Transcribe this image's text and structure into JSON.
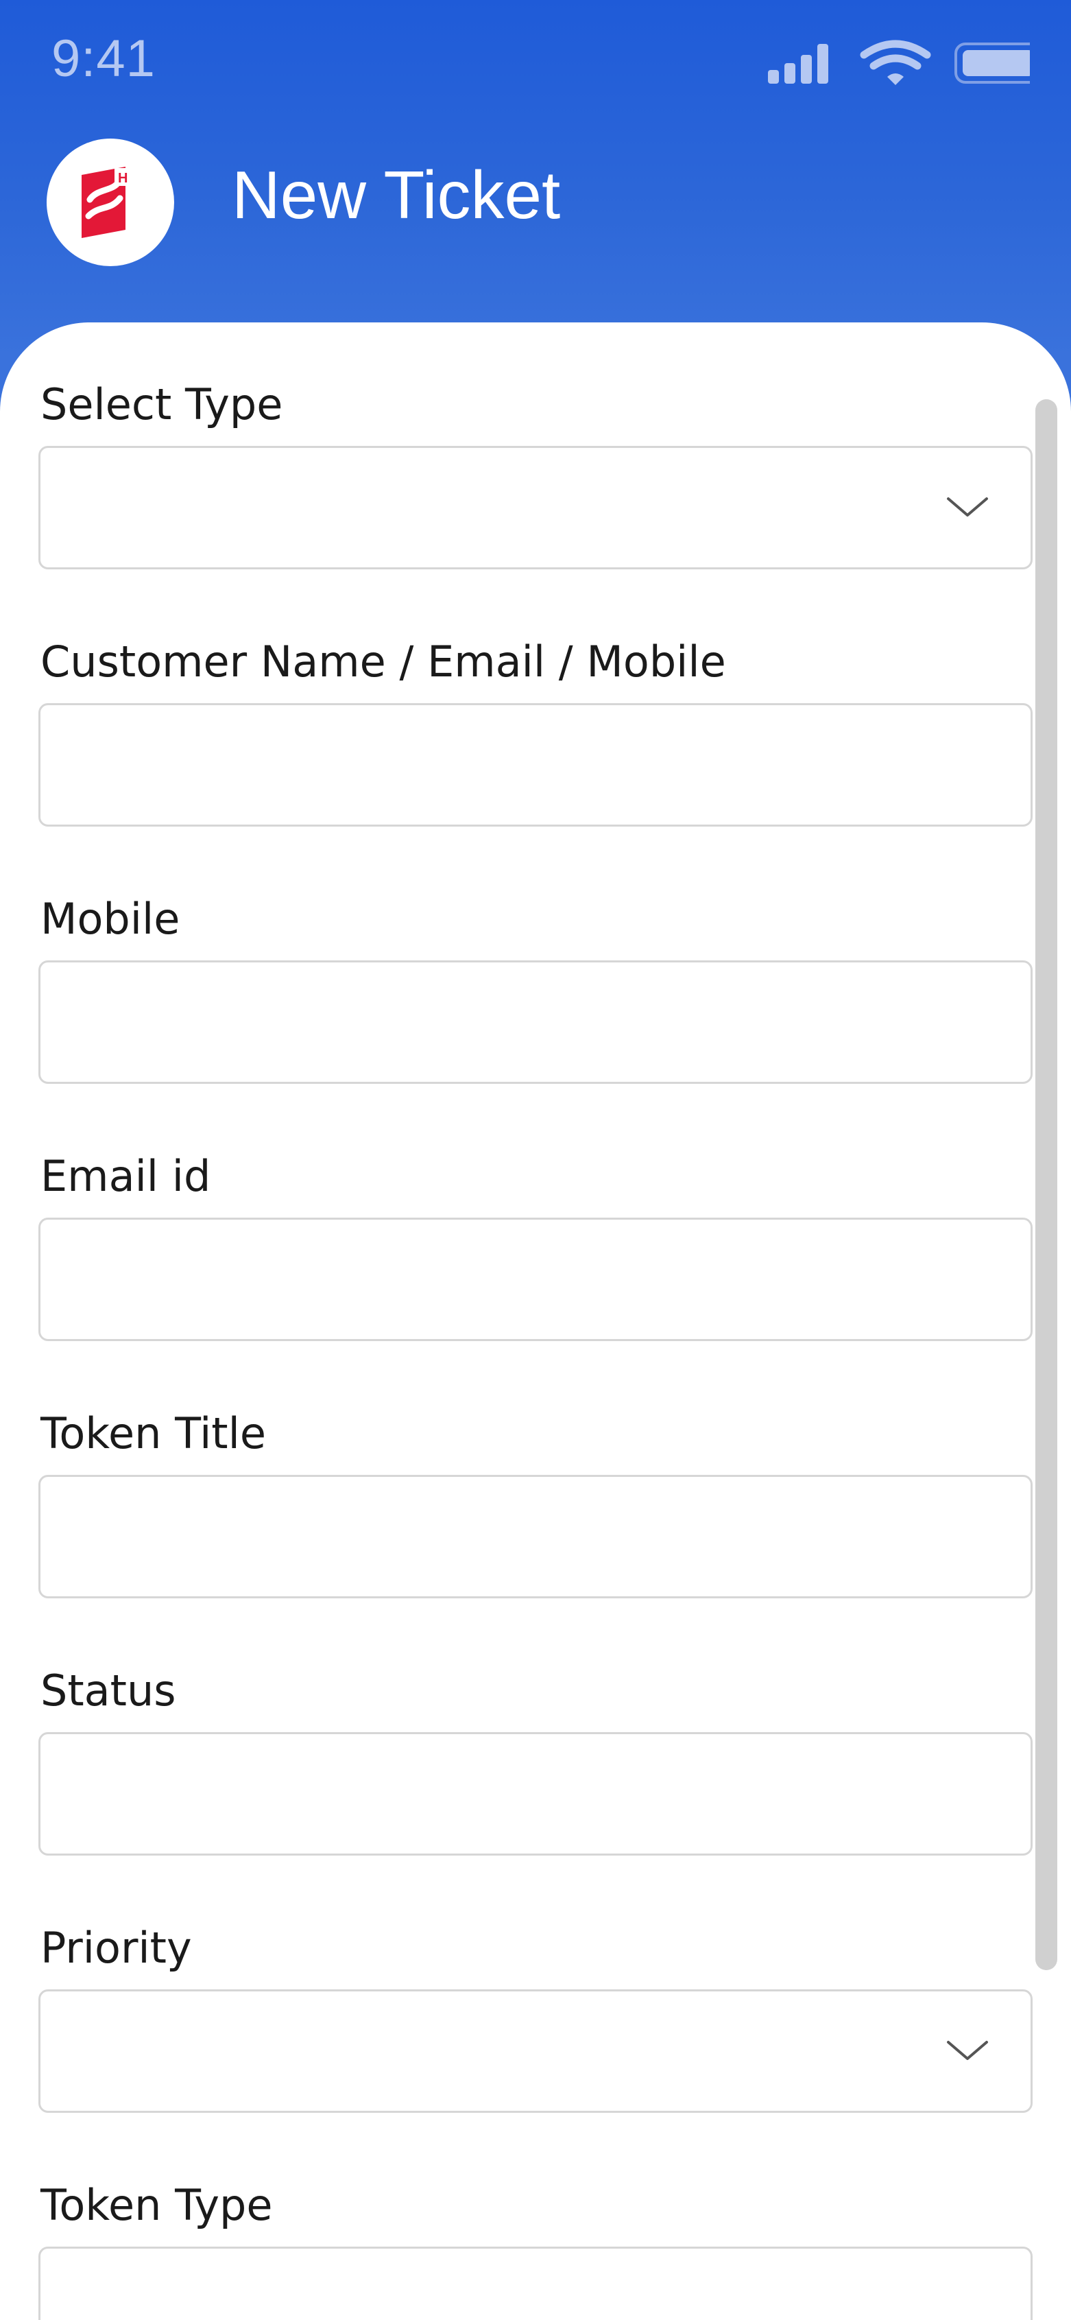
{
  "status_bar": {
    "time": "9:41",
    "icons": [
      "signal-icon",
      "wifi-icon",
      "battery-icon"
    ]
  },
  "header": {
    "title": "New Ticket",
    "logo_letters": "S",
    "logo_badge": "H"
  },
  "colors": {
    "header_blue": "#1f5bd8",
    "logo_red": "#e31837",
    "label_text": "#1a1a1a",
    "field_border": "#d6d6d6"
  },
  "form": {
    "fields": [
      {
        "label": "Select Type",
        "kind": "select",
        "value": ""
      },
      {
        "label": "Customer Name / Email / Mobile",
        "kind": "text",
        "value": ""
      },
      {
        "label": "Mobile",
        "kind": "text",
        "value": ""
      },
      {
        "label": "Email id",
        "kind": "text",
        "value": ""
      },
      {
        "label": "Token Title",
        "kind": "text",
        "value": ""
      },
      {
        "label": "Status",
        "kind": "text",
        "value": ""
      },
      {
        "label": "Priority",
        "kind": "select",
        "value": ""
      },
      {
        "label": "Token Type",
        "kind": "text",
        "value": ""
      }
    ]
  }
}
